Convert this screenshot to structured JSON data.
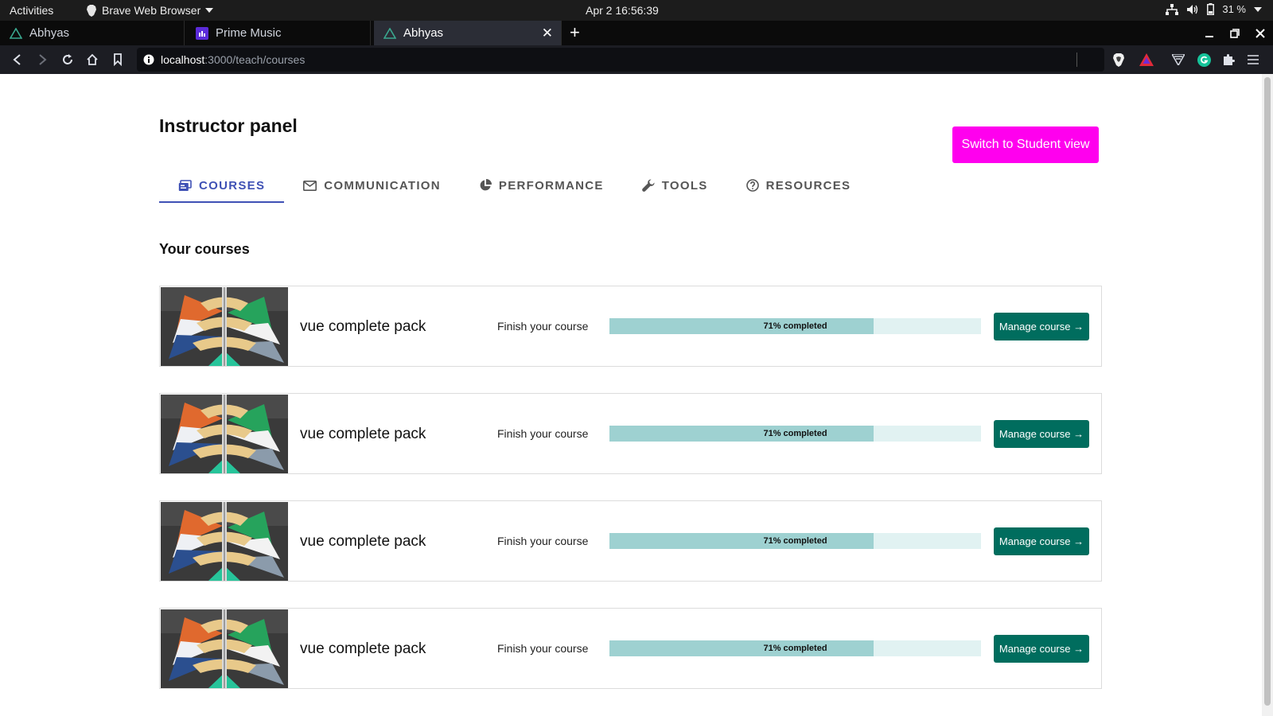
{
  "system_bar": {
    "activities": "Activities",
    "app_name": "Brave Web Browser",
    "clock": "Apr 2  16:56:39",
    "battery": "31 %"
  },
  "browser": {
    "tabs": [
      {
        "label": "Abhyas",
        "active": false
      },
      {
        "label": "Prime Music",
        "active": false
      },
      {
        "label": "Abhyas",
        "active": true
      }
    ],
    "url_host": "localhost",
    "url_rest": ":3000/teach/courses"
  },
  "page": {
    "title": "Instructor panel",
    "switch_button": "Switch to Student view",
    "nav_tabs": [
      {
        "label": "COURSES",
        "icon": "courses-icon",
        "active": true
      },
      {
        "label": "COMMUNICATION",
        "icon": "mail-icon",
        "active": false
      },
      {
        "label": "PERFORMANCE",
        "icon": "pie-chart-icon",
        "active": false
      },
      {
        "label": "TOOLS",
        "icon": "wrench-icon",
        "active": false
      },
      {
        "label": "RESOURCES",
        "icon": "help-circle-icon",
        "active": false
      }
    ],
    "section_title": "Your courses",
    "courses": [
      {
        "name": "vue complete pack",
        "status": "Finish your course",
        "progress": 71,
        "progress_label": "71% completed",
        "action": "Manage course →"
      },
      {
        "name": "vue complete pack",
        "status": "Finish your course",
        "progress": 71,
        "progress_label": "71% completed",
        "action": "Manage course →"
      },
      {
        "name": "vue complete pack",
        "status": "Finish your course",
        "progress": 71,
        "progress_label": "71% completed",
        "action": "Manage course →"
      },
      {
        "name": "vue complete pack",
        "status": "Finish your course",
        "progress": 71,
        "progress_label": "71% completed",
        "action": "Manage course →"
      }
    ]
  },
  "colors": {
    "accent_magenta": "#ff00ee",
    "tab_active": "#3f51b5",
    "manage_button": "#006d5e",
    "progress_fill": "#9ed1d1",
    "progress_track": "#e1f2f2"
  }
}
